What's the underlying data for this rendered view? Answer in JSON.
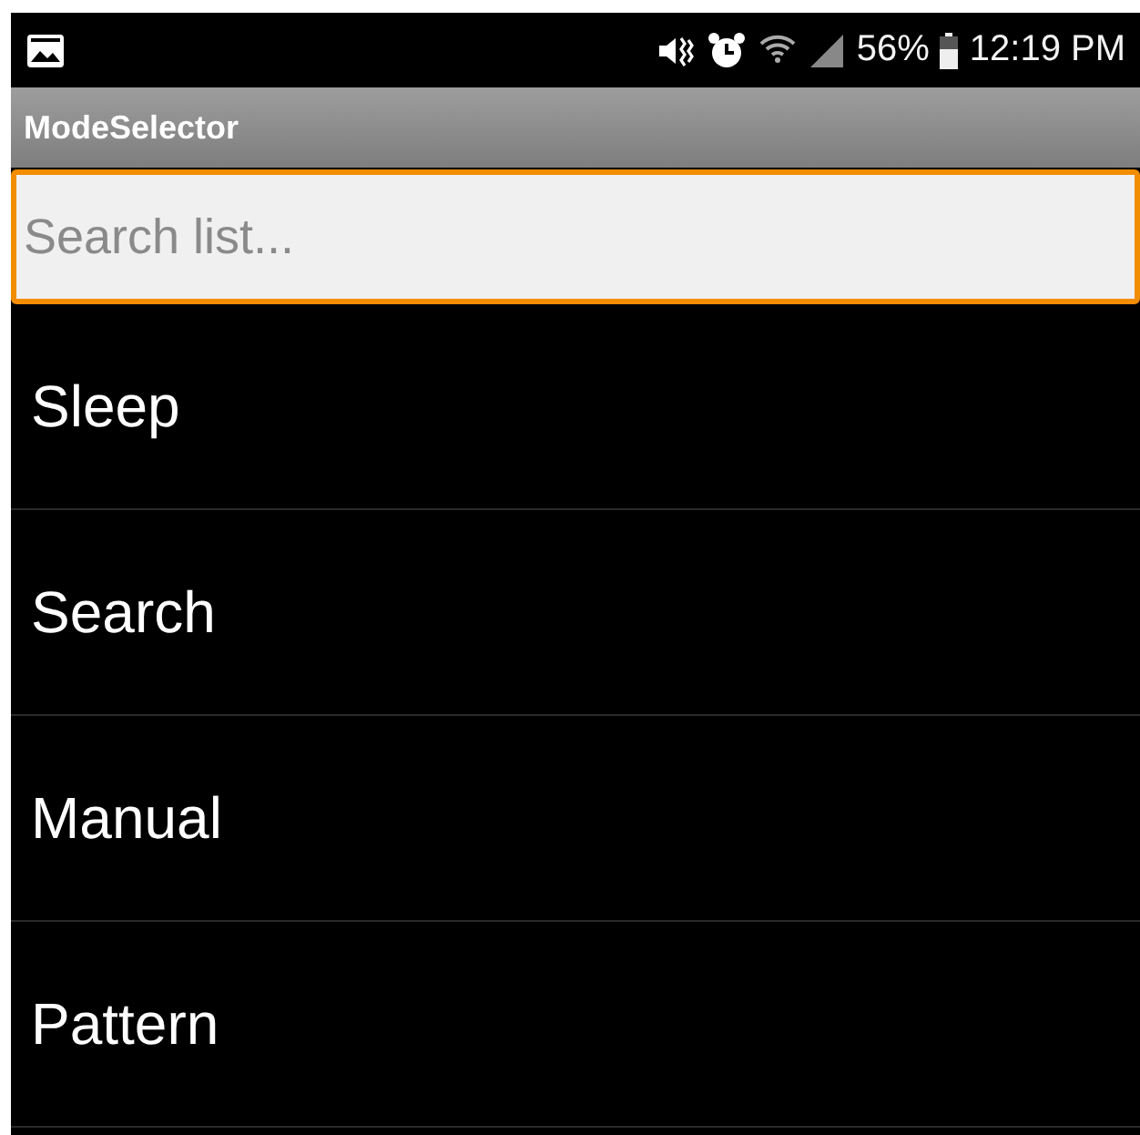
{
  "status_bar": {
    "battery": "56%",
    "time": "12:19 PM"
  },
  "window": {
    "title": "ModeSelector"
  },
  "search": {
    "placeholder": "Search list..."
  },
  "items": [
    {
      "label": "Sleep"
    },
    {
      "label": "Search"
    },
    {
      "label": "Manual"
    },
    {
      "label": "Pattern"
    }
  ]
}
